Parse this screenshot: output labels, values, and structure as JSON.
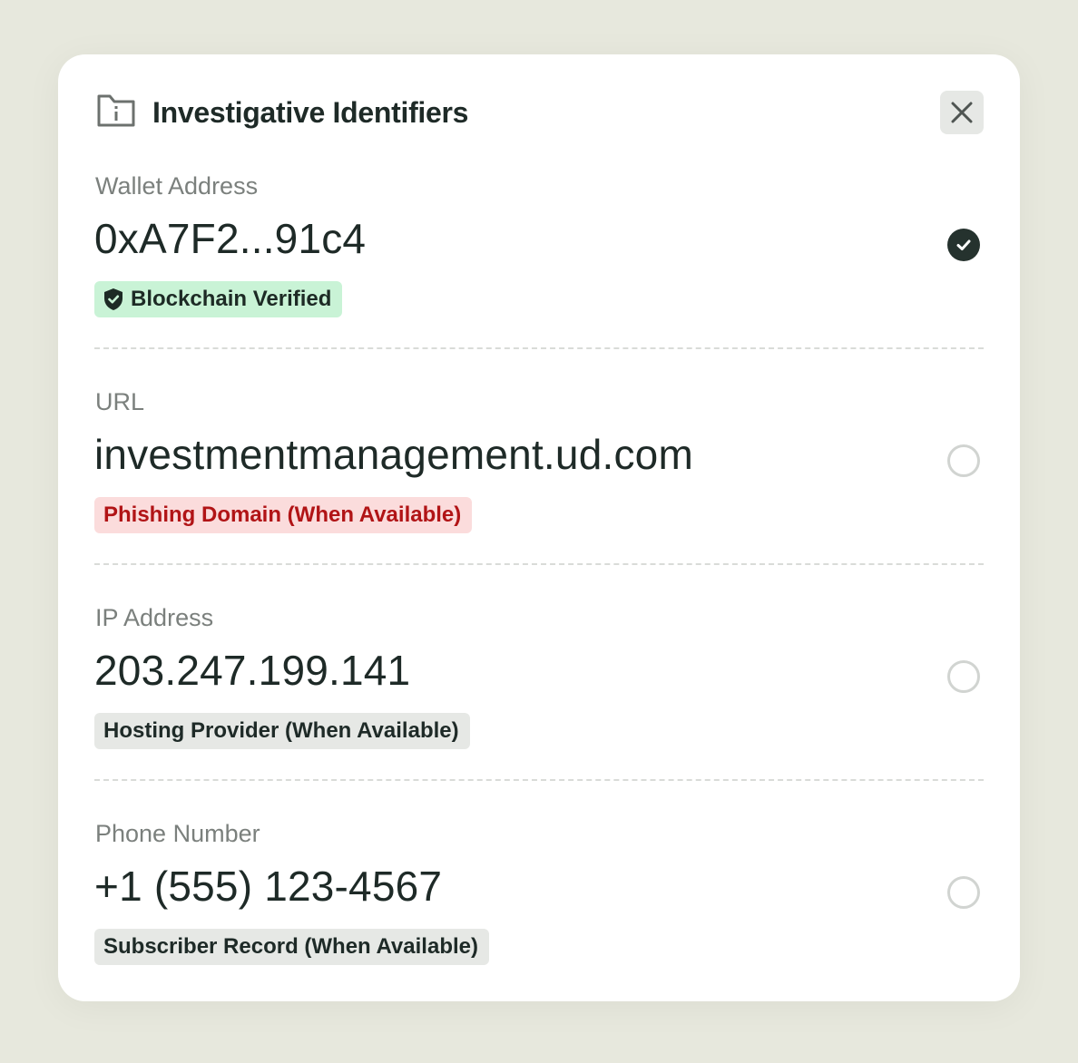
{
  "header": {
    "title": "Investigative Identifiers",
    "icon": "folder-info-icon",
    "close_icon": "close-icon"
  },
  "identifiers": [
    {
      "label": "Wallet Address",
      "value": "0xA7F2...91c4",
      "badge": "Blockchain Verified",
      "badge_style": "green",
      "badge_icon": "shield-check-icon",
      "selected": true
    },
    {
      "label": "URL",
      "value": "investmentmanagement.ud.com",
      "badge": "Phishing Domain (When Available)",
      "badge_style": "red",
      "selected": false
    },
    {
      "label": "IP Address",
      "value": "203.247.199.141",
      "badge": "Hosting Provider (When Available)",
      "badge_style": "gray",
      "selected": false
    },
    {
      "label": "Phone Number",
      "value": "+1 (555) 123-4567",
      "badge": "Subscriber Record (When Available)",
      "badge_style": "gray",
      "selected": false
    }
  ],
  "colors": {
    "background": "#e7e8dd",
    "card": "#ffffff",
    "text_primary": "#1e2a27",
    "label": "#7b807d",
    "green_badge": "#c9f3d6",
    "red_badge": "#fbdcdc",
    "red_text": "#b11416",
    "gray_badge": "#e6e8e5",
    "check_fill": "#25322e"
  }
}
